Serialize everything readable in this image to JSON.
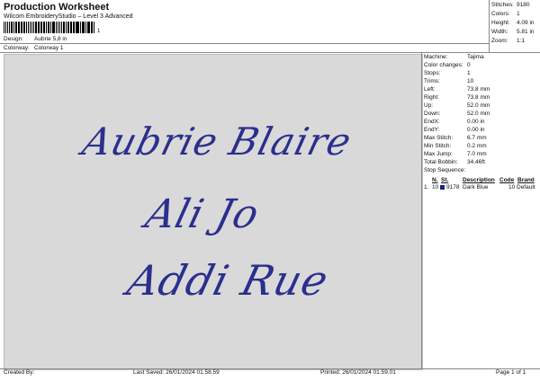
{
  "title": "Production Worksheet",
  "subtitle": "Wilcom EmbroideryStudio – Level 3 Advanced",
  "barcode": {
    "suffix": "1"
  },
  "design": {
    "label": "Design:",
    "value": "Aubrie 5,8 in"
  },
  "colorway": {
    "label": "Colorway:",
    "value": "Colorway 1"
  },
  "summary": [
    {
      "label": "Stitches:",
      "value": "9180"
    },
    {
      "label": "Colors:",
      "value": "1"
    },
    {
      "label": "Height:",
      "value": "4.09 in"
    },
    {
      "label": "Width:",
      "value": "5.81 in"
    },
    {
      "label": "Zoom:",
      "value": "1:1"
    }
  ],
  "design_text": {
    "line1": "Aubrie Blaire",
    "line2": "Ali Jo",
    "line3": "Addi Rue"
  },
  "thread_color": "#2b2f8c",
  "details": [
    {
      "label": "Machine:",
      "value": "Tajima"
    },
    {
      "label": "Color changes:",
      "value": "0"
    },
    {
      "label": "Stops:",
      "value": "1"
    },
    {
      "label": "Trims:",
      "value": "10"
    },
    {
      "label": "Left:",
      "value": "73.8 mm"
    },
    {
      "label": "Right:",
      "value": "73.8 mm"
    },
    {
      "label": "Up:",
      "value": "52.0 mm"
    },
    {
      "label": "Down:",
      "value": "52.0 mm"
    },
    {
      "label": "EndX:",
      "value": "0.00 in"
    },
    {
      "label": "EndY:",
      "value": "0.00 in"
    },
    {
      "label": "Max Stitch:",
      "value": "6.7 mm"
    },
    {
      "label": "Min Stitch:",
      "value": "0.2 mm"
    },
    {
      "label": "Max Jump:",
      "value": "7.0 mm"
    },
    {
      "label": "Total Bobbin:",
      "value": "34.46ft"
    }
  ],
  "stop_sequence": {
    "label": "Stop Sequence:",
    "headers": {
      "n": "N.",
      "st": "St.",
      "description": "Description",
      "code": "Code",
      "brand": "Brand"
    },
    "row": {
      "stop": "1.",
      "n": "10",
      "st": "9178",
      "description": "Dark Blue",
      "code": "10",
      "brand": "Default",
      "color": "#1a237e"
    }
  },
  "footer": {
    "created_by": "Created By:",
    "last_saved": "Last Saved: 26/01/2024 01.58.59",
    "printed": "Printed: 26/01/2024 01.59.01",
    "page": "Page 1 of 1"
  }
}
